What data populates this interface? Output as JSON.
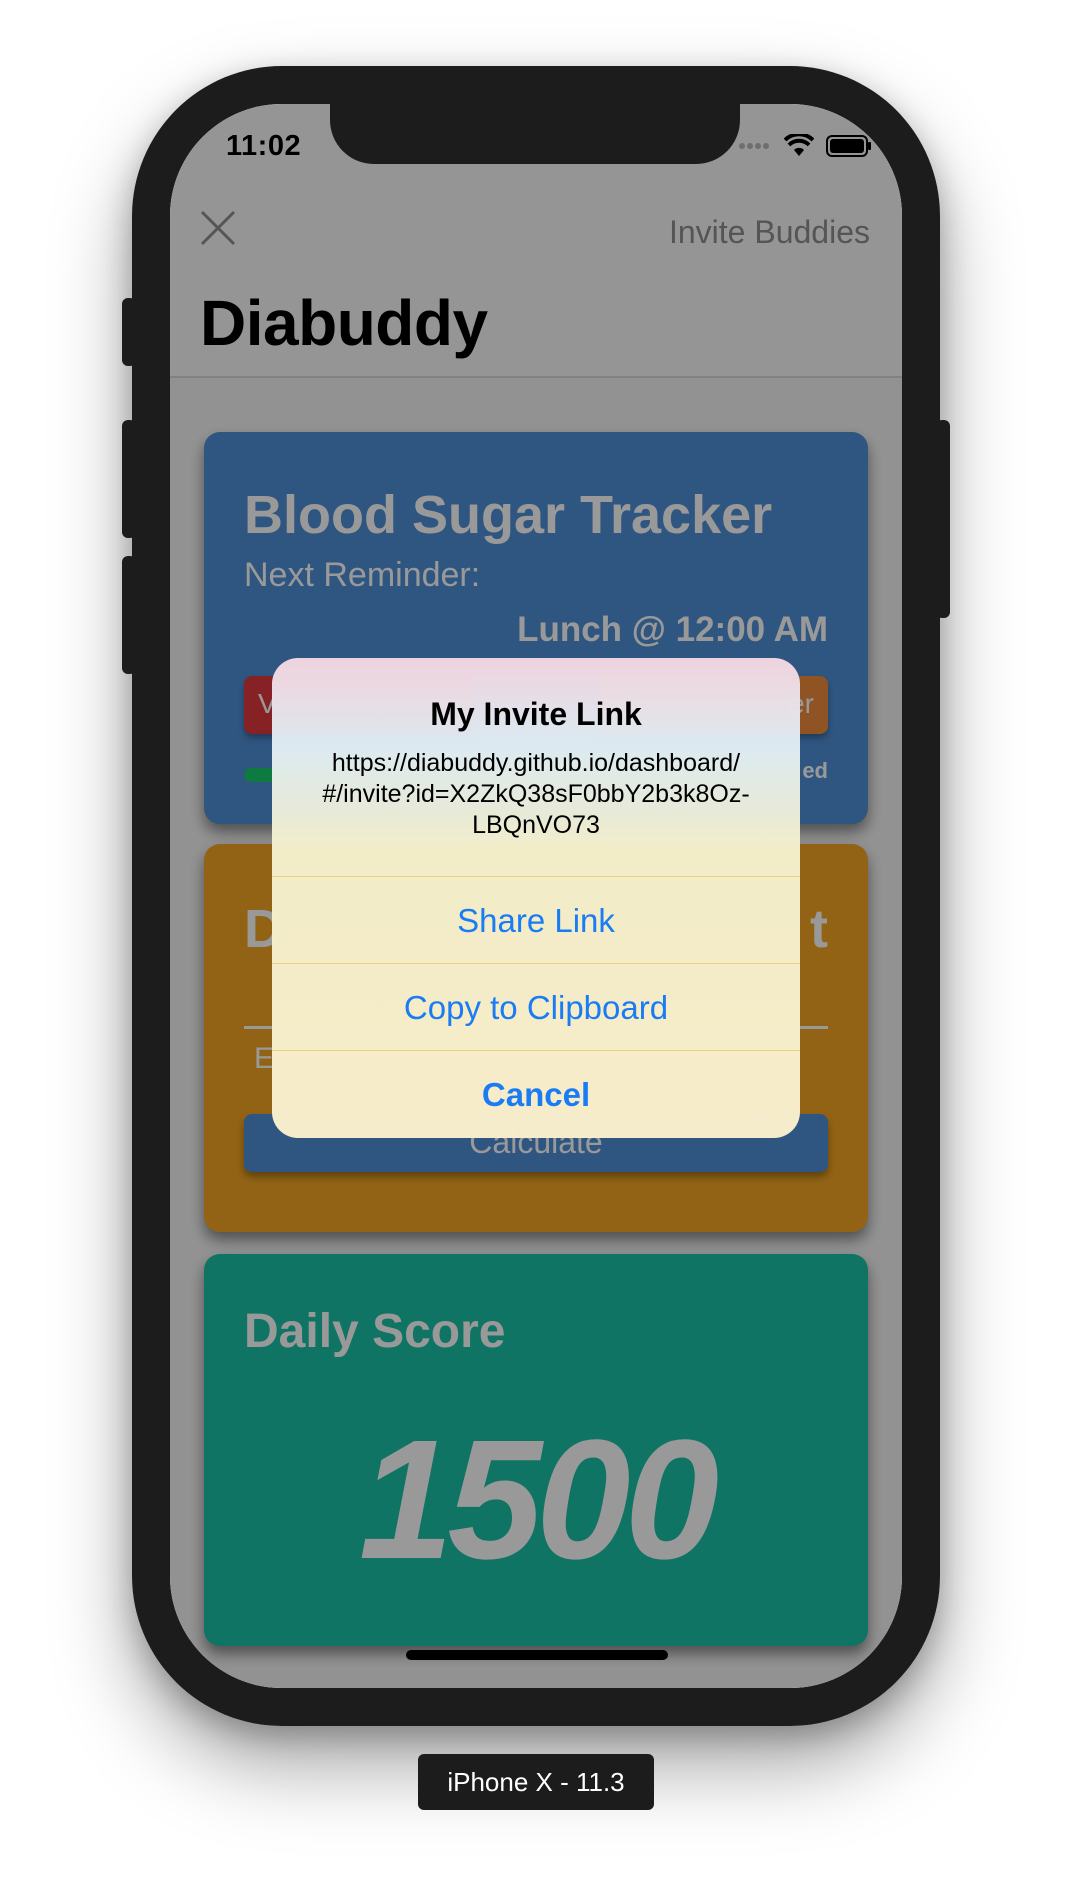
{
  "status_bar": {
    "time": "11:02"
  },
  "navbar": {
    "close_icon": "close-icon",
    "right_button": "Invite Buddies",
    "title": "Diabuddy"
  },
  "cards": {
    "blood_sugar": {
      "title": "Blood Sugar Tracker",
      "subtitle": "Next Reminder:",
      "reminder": "Lunch @ 12:00 AM",
      "left_button": "V",
      "right_button": "er",
      "progress_label": "ed"
    },
    "calculator": {
      "title_left": "D",
      "title_right": "t",
      "entry_label": "E",
      "button": "Calculate"
    },
    "daily_score": {
      "title": "Daily Score",
      "value": "1500"
    }
  },
  "alert": {
    "title": "My Invite Link",
    "message_line1": "https://diabuddy.github.io/dashboard/",
    "message_line2": "#/invite?id=X2ZkQ38sF0bbY2b3k8Oz-",
    "message_line3": "LBQnVO73",
    "actions": [
      {
        "label": "Share Link"
      },
      {
        "label": "Copy to Clipboard"
      },
      {
        "label": "Cancel"
      }
    ],
    "action_color": "#1a7cf5"
  },
  "device_label": "iPhone X - 11.3",
  "colors": {
    "blue_card": "#4f8fd6",
    "orange_card": "#f5a623",
    "green_card": "#19c1a5",
    "overlay": "rgba(0,0,0,0.40)"
  }
}
